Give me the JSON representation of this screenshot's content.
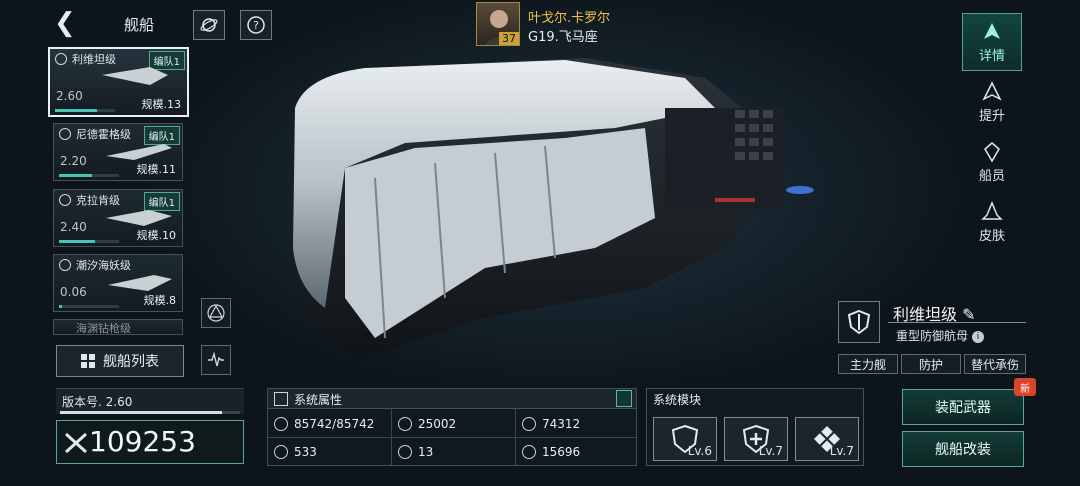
{
  "header": {
    "title": "舰船"
  },
  "player": {
    "name": "叶戈尔.卡罗尔",
    "level": "37",
    "sector": "G19.飞马座"
  },
  "fleet": [
    {
      "name": "利维坦级",
      "badge": "编队1",
      "power": "2.60",
      "scale": "规模.13",
      "progress": 0.7,
      "selected": true
    },
    {
      "name": "尼德霍格级",
      "badge": "编队1",
      "power": "2.20",
      "scale": "规模.11",
      "progress": 0.55,
      "selected": false
    },
    {
      "name": "克拉肯级",
      "badge": "编队1",
      "power": "2.40",
      "scale": "规模.10",
      "progress": 0.6,
      "selected": false
    },
    {
      "name": "潮汐海妖级",
      "badge": "",
      "power": "0.06",
      "scale": "规模.8",
      "progress": 0.05,
      "selected": false
    },
    {
      "name": "海渊钻枪级",
      "badge": "",
      "power": "",
      "scale": "",
      "progress": 0,
      "selected": false
    }
  ],
  "list_button": "舰船列表",
  "version": {
    "label": "版本号. 2.60",
    "progress": 0.9
  },
  "power": {
    "value": "109253"
  },
  "attributes": {
    "title": "系统属性",
    "items": [
      "85742/85742",
      "25002",
      "74312",
      "533",
      "13",
      "15696"
    ]
  },
  "modules": {
    "title": "系统模块",
    "items": [
      {
        "level": "Lv.6"
      },
      {
        "level": "Lv.7"
      },
      {
        "level": "Lv.7"
      }
    ]
  },
  "nav": {
    "details": "详情",
    "upgrade": "提升",
    "crew": "船员",
    "skin": "皮肤"
  },
  "ship": {
    "name": "利维坦级",
    "class": "重型防御航母",
    "tags": [
      "主力舰",
      "防护",
      "替代承伤"
    ]
  },
  "actions": {
    "equip": "装配武器",
    "modify": "舰船改装",
    "new_badge": "新"
  },
  "colors": {
    "accent": "#4aa49a",
    "gold": "#f0c24a",
    "new": "#d9452a"
  }
}
